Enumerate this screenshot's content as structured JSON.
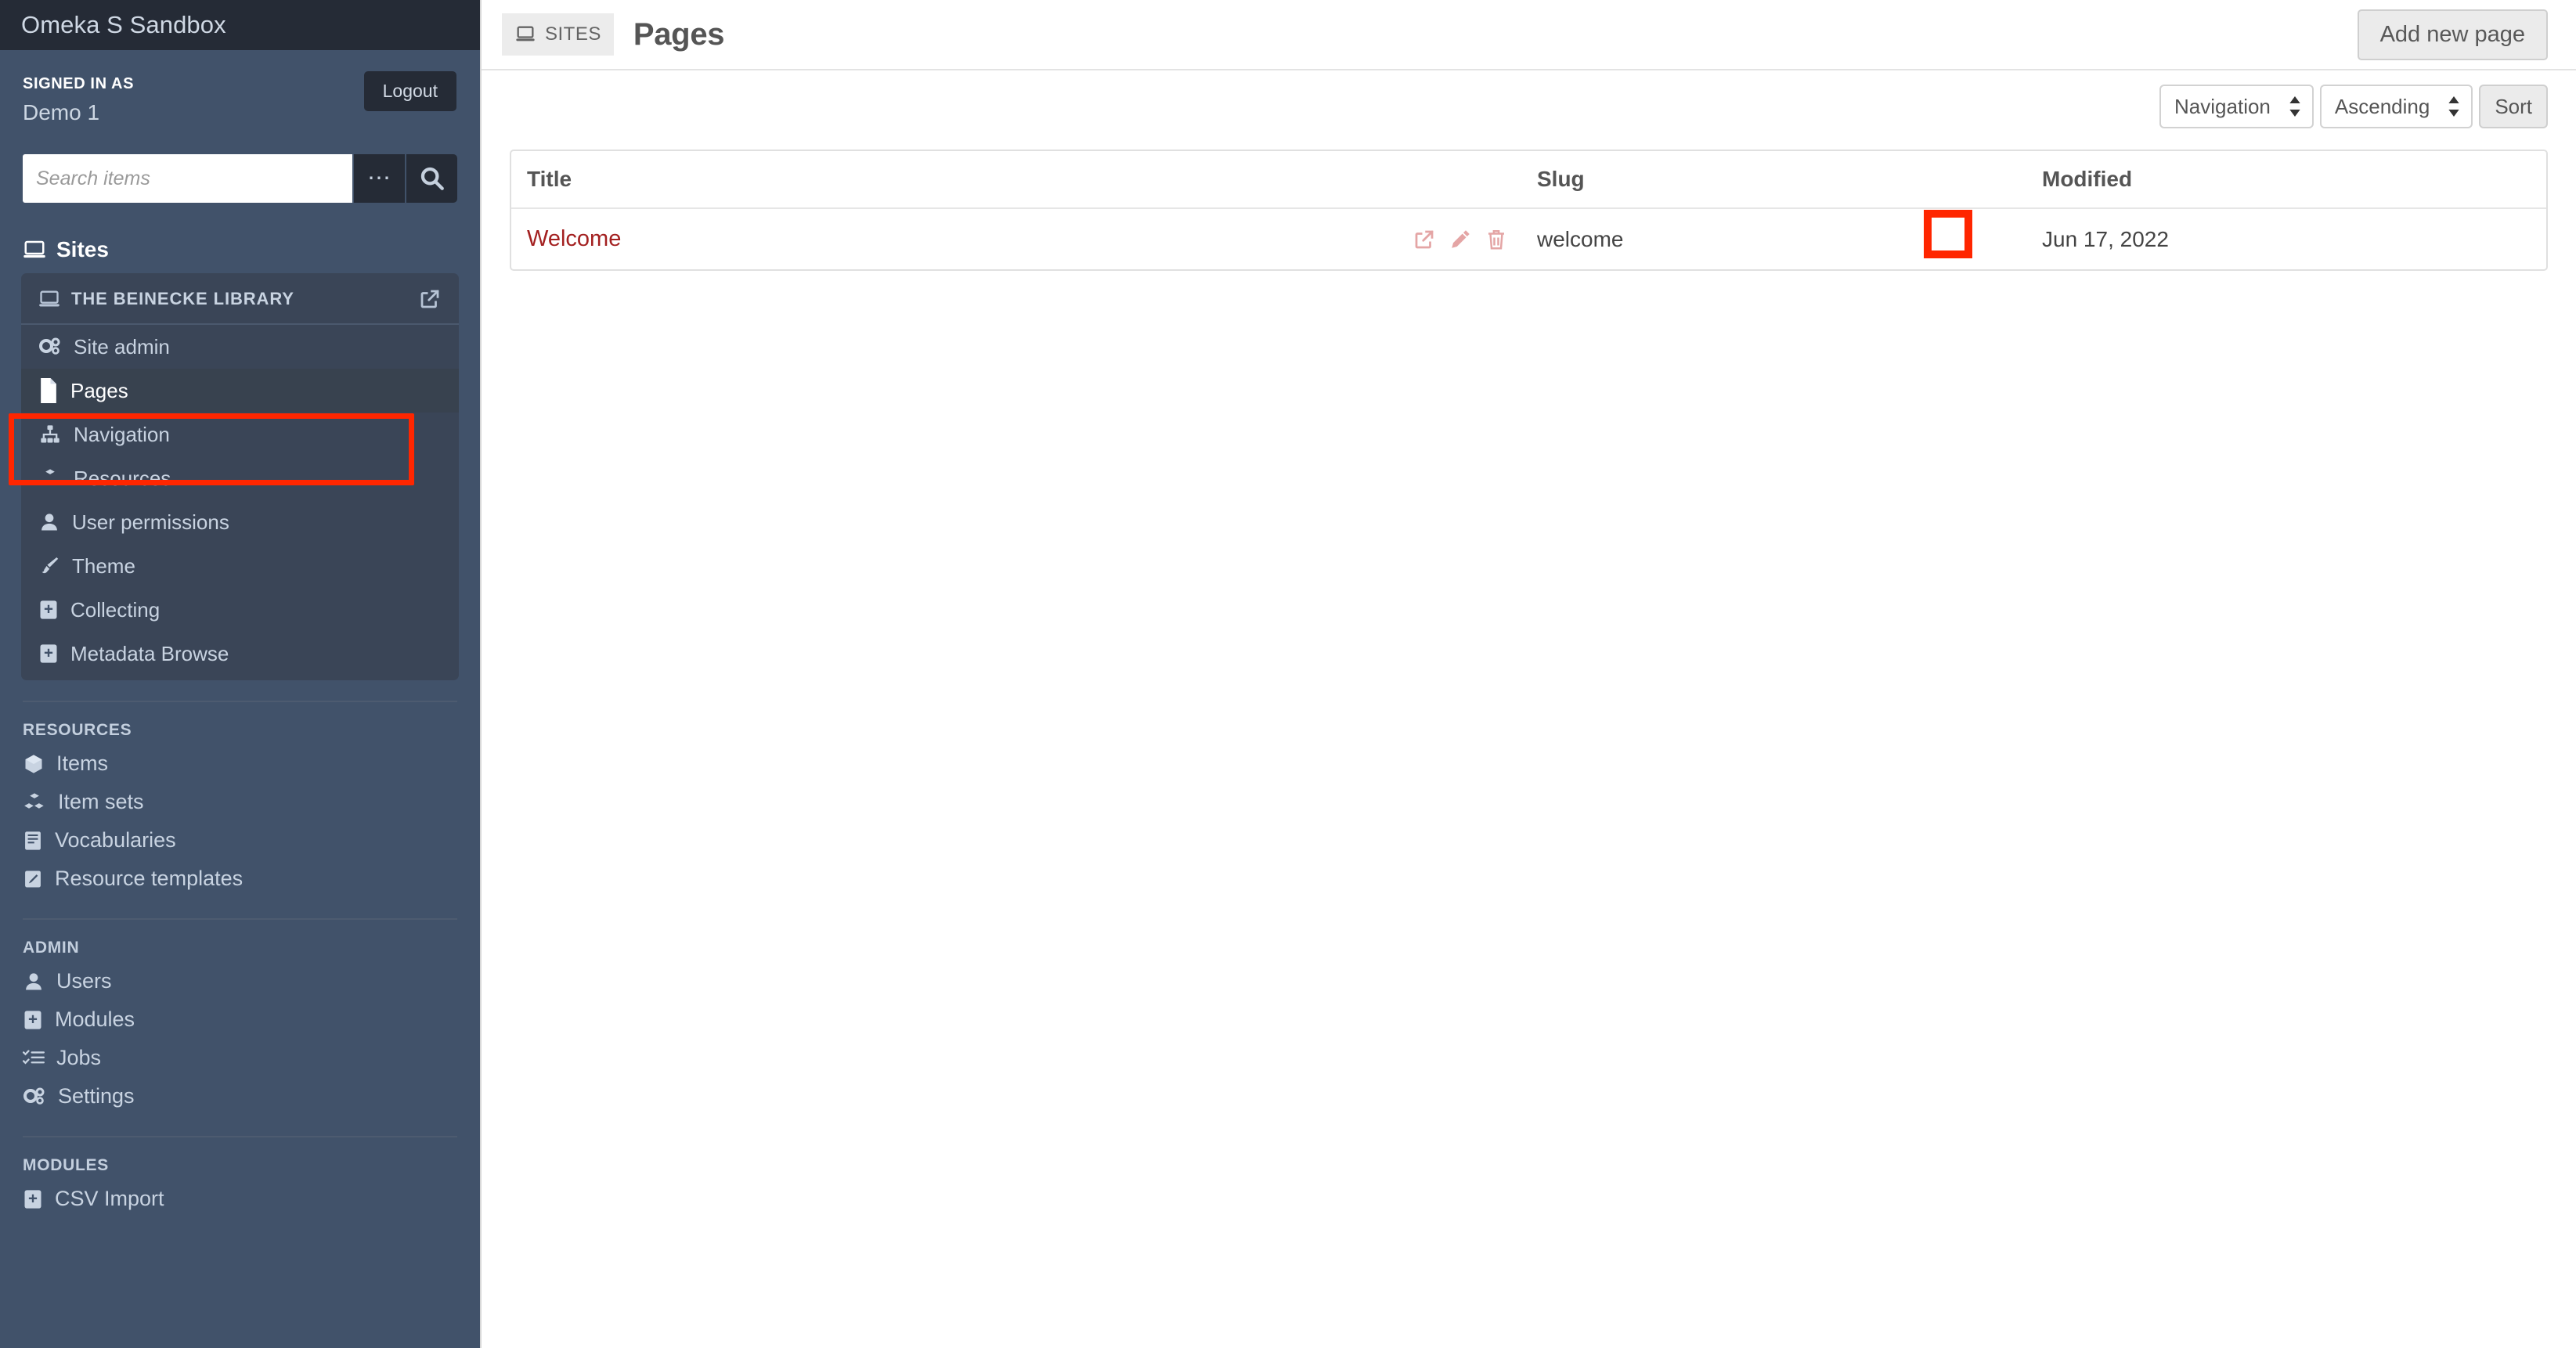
{
  "sidebar": {
    "brand_title": "Omeka S Sandbox",
    "signed_in_label": "SIGNED IN AS",
    "user_name": "Demo 1",
    "logout_label": "Logout",
    "search_placeholder": "Search items",
    "search_value": "",
    "advanced_search_icon": "ellipsis-icon",
    "search_icon": "search-icon",
    "sites_heading": "Sites",
    "sites_heading_icon": "laptop-icon",
    "site_panel": {
      "title": "THE BEINECKE LIBRARY",
      "title_icon": "laptop-icon",
      "open_site_icon": "external-link-icon",
      "items": [
        {
          "label": "Site admin",
          "icon": "gears-icon",
          "active": false
        },
        {
          "label": "Pages",
          "icon": "file-icon",
          "active": true
        },
        {
          "label": "Navigation",
          "icon": "sitemap-icon",
          "active": false
        },
        {
          "label": "Resources",
          "icon": "cubes-icon",
          "active": false
        },
        {
          "label": "User permissions",
          "icon": "user-icon",
          "active": false
        },
        {
          "label": "Theme",
          "icon": "paintbrush-icon",
          "active": false
        },
        {
          "label": "Collecting",
          "icon": "puzzle-icon",
          "active": false
        },
        {
          "label": "Metadata Browse",
          "icon": "puzzle-icon",
          "active": false
        }
      ]
    },
    "groups": [
      {
        "label": "RESOURCES",
        "items": [
          {
            "label": "Items",
            "icon": "cube-icon"
          },
          {
            "label": "Item sets",
            "icon": "cubes-icon"
          },
          {
            "label": "Vocabularies",
            "icon": "book-icon"
          },
          {
            "label": "Resource templates",
            "icon": "pencil-square-icon"
          }
        ]
      },
      {
        "label": "ADMIN",
        "items": [
          {
            "label": "Users",
            "icon": "user-icon"
          },
          {
            "label": "Modules",
            "icon": "puzzle-icon"
          },
          {
            "label": "Jobs",
            "icon": "tasks-icon"
          },
          {
            "label": "Settings",
            "icon": "gears-icon"
          }
        ]
      },
      {
        "label": "MODULES",
        "items": [
          {
            "label": "CSV Import",
            "icon": "puzzle-icon"
          }
        ]
      }
    ]
  },
  "header": {
    "breadcrumb_badge": "SITES",
    "breadcrumb_badge_icon": "laptop-icon",
    "page_title": "Pages",
    "add_new_label": "Add new page"
  },
  "sort_bar": {
    "sort_by_value": "Navigation",
    "sort_dir_value": "Ascending",
    "sort_button_label": "Sort",
    "caret_icon": "sort-caret-icon"
  },
  "table": {
    "columns": [
      "Title",
      "Slug",
      "Modified"
    ],
    "rows": [
      {
        "title": "Welcome",
        "slug": "welcome",
        "modified": "Jun 17, 2022",
        "actions": [
          {
            "name": "view-page-icon",
            "label": "View page"
          },
          {
            "name": "edit-page-icon",
            "label": "Edit page"
          },
          {
            "name": "delete-page-icon",
            "label": "Delete page"
          }
        ]
      }
    ]
  },
  "annotations": {
    "highlight_color": "#ff2600",
    "sidebar_target": "Pages",
    "row_target": "Edit page"
  }
}
